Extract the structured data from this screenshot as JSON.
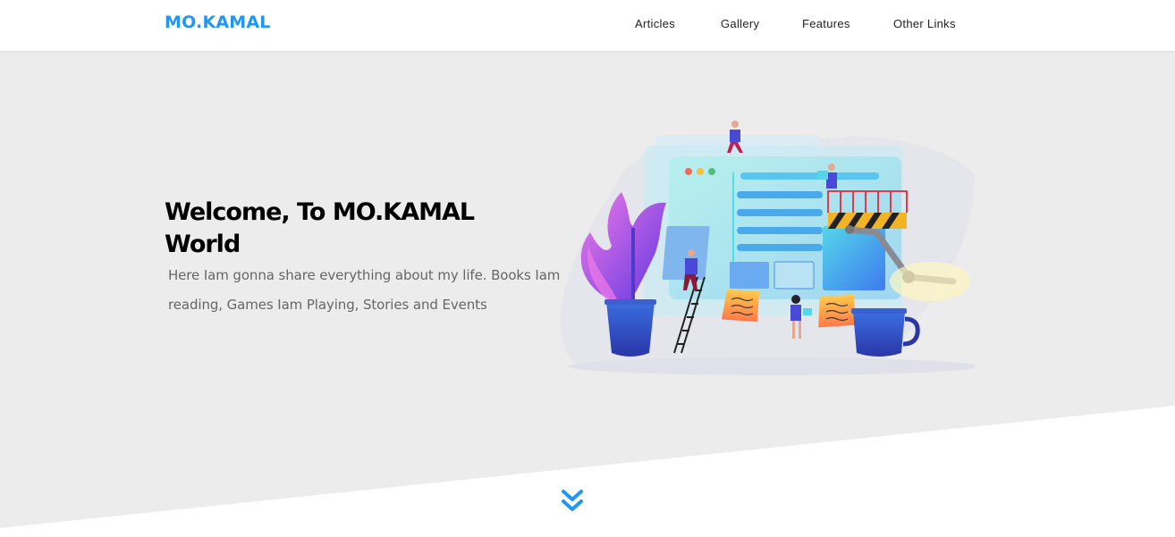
{
  "header": {
    "logo": "MO.KAMAL",
    "nav": [
      {
        "label": "Articles"
      },
      {
        "label": "Gallery"
      },
      {
        "label": "Features"
      },
      {
        "label": "Other Links"
      }
    ]
  },
  "hero": {
    "title": "Welcome, To MO.KAMAL World",
    "text": "Here Iam gonna share everything about my life. Books Iam reading, Games Iam Playing, Stories and Events",
    "illustration": "web-design-team-illustration",
    "scroll_icon": "chevrons-down-icon"
  },
  "colors": {
    "accent": "#2196f3",
    "hero_bg": "#ececec",
    "text_dark": "#000000",
    "text_muted": "#666666"
  }
}
